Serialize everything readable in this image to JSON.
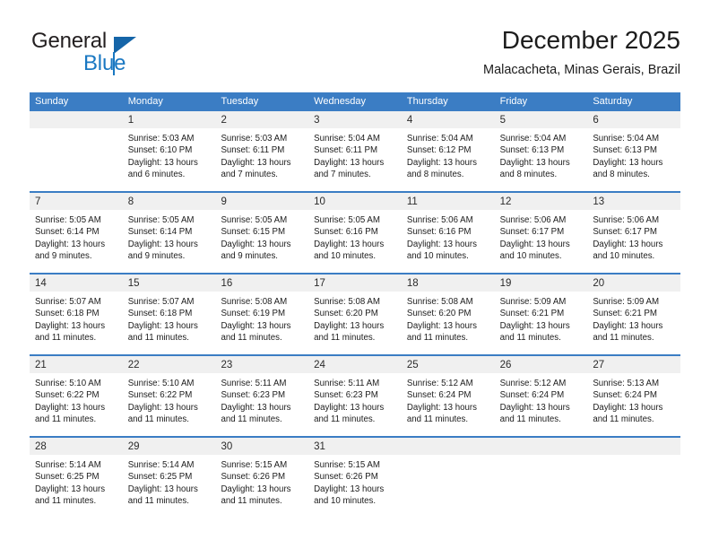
{
  "logo": {
    "text_primary": "General",
    "text_secondary": "Blue",
    "triangle_icon": "triangle-icon",
    "accent_color": "#1a78c2"
  },
  "header": {
    "title": "December 2025",
    "subtitle": "Malacacheta, Minas Gerais, Brazil"
  },
  "calendar": {
    "header_color": "#3b7dc4",
    "weekdays": [
      "Sunday",
      "Monday",
      "Tuesday",
      "Wednesday",
      "Thursday",
      "Friday",
      "Saturday"
    ],
    "weeks": [
      [
        {
          "day": "",
          "lines": []
        },
        {
          "day": "1",
          "lines": [
            "Sunrise: 5:03 AM",
            "Sunset: 6:10 PM",
            "Daylight: 13 hours",
            "and 6 minutes."
          ]
        },
        {
          "day": "2",
          "lines": [
            "Sunrise: 5:03 AM",
            "Sunset: 6:11 PM",
            "Daylight: 13 hours",
            "and 7 minutes."
          ]
        },
        {
          "day": "3",
          "lines": [
            "Sunrise: 5:04 AM",
            "Sunset: 6:11 PM",
            "Daylight: 13 hours",
            "and 7 minutes."
          ]
        },
        {
          "day": "4",
          "lines": [
            "Sunrise: 5:04 AM",
            "Sunset: 6:12 PM",
            "Daylight: 13 hours",
            "and 8 minutes."
          ]
        },
        {
          "day": "5",
          "lines": [
            "Sunrise: 5:04 AM",
            "Sunset: 6:13 PM",
            "Daylight: 13 hours",
            "and 8 minutes."
          ]
        },
        {
          "day": "6",
          "lines": [
            "Sunrise: 5:04 AM",
            "Sunset: 6:13 PM",
            "Daylight: 13 hours",
            "and 8 minutes."
          ]
        }
      ],
      [
        {
          "day": "7",
          "lines": [
            "Sunrise: 5:05 AM",
            "Sunset: 6:14 PM",
            "Daylight: 13 hours",
            "and 9 minutes."
          ]
        },
        {
          "day": "8",
          "lines": [
            "Sunrise: 5:05 AM",
            "Sunset: 6:14 PM",
            "Daylight: 13 hours",
            "and 9 minutes."
          ]
        },
        {
          "day": "9",
          "lines": [
            "Sunrise: 5:05 AM",
            "Sunset: 6:15 PM",
            "Daylight: 13 hours",
            "and 9 minutes."
          ]
        },
        {
          "day": "10",
          "lines": [
            "Sunrise: 5:05 AM",
            "Sunset: 6:16 PM",
            "Daylight: 13 hours",
            "and 10 minutes."
          ]
        },
        {
          "day": "11",
          "lines": [
            "Sunrise: 5:06 AM",
            "Sunset: 6:16 PM",
            "Daylight: 13 hours",
            "and 10 minutes."
          ]
        },
        {
          "day": "12",
          "lines": [
            "Sunrise: 5:06 AM",
            "Sunset: 6:17 PM",
            "Daylight: 13 hours",
            "and 10 minutes."
          ]
        },
        {
          "day": "13",
          "lines": [
            "Sunrise: 5:06 AM",
            "Sunset: 6:17 PM",
            "Daylight: 13 hours",
            "and 10 minutes."
          ]
        }
      ],
      [
        {
          "day": "14",
          "lines": [
            "Sunrise: 5:07 AM",
            "Sunset: 6:18 PM",
            "Daylight: 13 hours",
            "and 11 minutes."
          ]
        },
        {
          "day": "15",
          "lines": [
            "Sunrise: 5:07 AM",
            "Sunset: 6:18 PM",
            "Daylight: 13 hours",
            "and 11 minutes."
          ]
        },
        {
          "day": "16",
          "lines": [
            "Sunrise: 5:08 AM",
            "Sunset: 6:19 PM",
            "Daylight: 13 hours",
            "and 11 minutes."
          ]
        },
        {
          "day": "17",
          "lines": [
            "Sunrise: 5:08 AM",
            "Sunset: 6:20 PM",
            "Daylight: 13 hours",
            "and 11 minutes."
          ]
        },
        {
          "day": "18",
          "lines": [
            "Sunrise: 5:08 AM",
            "Sunset: 6:20 PM",
            "Daylight: 13 hours",
            "and 11 minutes."
          ]
        },
        {
          "day": "19",
          "lines": [
            "Sunrise: 5:09 AM",
            "Sunset: 6:21 PM",
            "Daylight: 13 hours",
            "and 11 minutes."
          ]
        },
        {
          "day": "20",
          "lines": [
            "Sunrise: 5:09 AM",
            "Sunset: 6:21 PM",
            "Daylight: 13 hours",
            "and 11 minutes."
          ]
        }
      ],
      [
        {
          "day": "21",
          "lines": [
            "Sunrise: 5:10 AM",
            "Sunset: 6:22 PM",
            "Daylight: 13 hours",
            "and 11 minutes."
          ]
        },
        {
          "day": "22",
          "lines": [
            "Sunrise: 5:10 AM",
            "Sunset: 6:22 PM",
            "Daylight: 13 hours",
            "and 11 minutes."
          ]
        },
        {
          "day": "23",
          "lines": [
            "Sunrise: 5:11 AM",
            "Sunset: 6:23 PM",
            "Daylight: 13 hours",
            "and 11 minutes."
          ]
        },
        {
          "day": "24",
          "lines": [
            "Sunrise: 5:11 AM",
            "Sunset: 6:23 PM",
            "Daylight: 13 hours",
            "and 11 minutes."
          ]
        },
        {
          "day": "25",
          "lines": [
            "Sunrise: 5:12 AM",
            "Sunset: 6:24 PM",
            "Daylight: 13 hours",
            "and 11 minutes."
          ]
        },
        {
          "day": "26",
          "lines": [
            "Sunrise: 5:12 AM",
            "Sunset: 6:24 PM",
            "Daylight: 13 hours",
            "and 11 minutes."
          ]
        },
        {
          "day": "27",
          "lines": [
            "Sunrise: 5:13 AM",
            "Sunset: 6:24 PM",
            "Daylight: 13 hours",
            "and 11 minutes."
          ]
        }
      ],
      [
        {
          "day": "28",
          "lines": [
            "Sunrise: 5:14 AM",
            "Sunset: 6:25 PM",
            "Daylight: 13 hours",
            "and 11 minutes."
          ]
        },
        {
          "day": "29",
          "lines": [
            "Sunrise: 5:14 AM",
            "Sunset: 6:25 PM",
            "Daylight: 13 hours",
            "and 11 minutes."
          ]
        },
        {
          "day": "30",
          "lines": [
            "Sunrise: 5:15 AM",
            "Sunset: 6:26 PM",
            "Daylight: 13 hours",
            "and 11 minutes."
          ]
        },
        {
          "day": "31",
          "lines": [
            "Sunrise: 5:15 AM",
            "Sunset: 6:26 PM",
            "Daylight: 13 hours",
            "and 10 minutes."
          ]
        },
        {
          "day": "",
          "lines": []
        },
        {
          "day": "",
          "lines": []
        },
        {
          "day": "",
          "lines": []
        }
      ]
    ]
  }
}
